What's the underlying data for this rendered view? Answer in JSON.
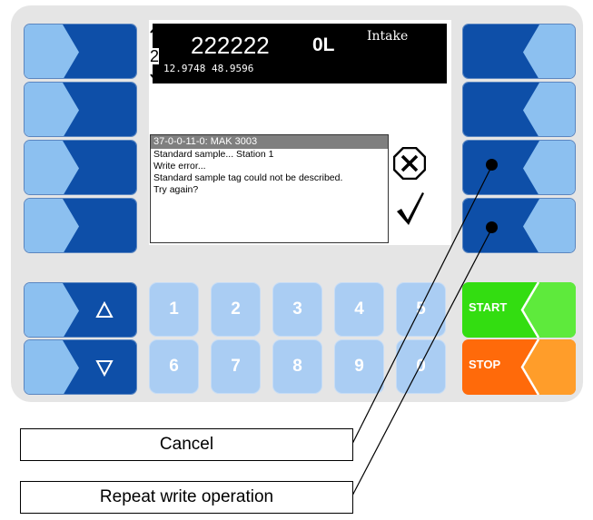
{
  "screen": {
    "page_number": "2",
    "volume_readout": "222222",
    "quantity_readout": "0L",
    "mode_label": "Intake",
    "coordinates": "12.9748 48.9596"
  },
  "message": {
    "title": "37-0-0-11-0: MAK 3003",
    "lines": [
      "Standard sample... Station 1",
      "Write error...",
      "Standard sample tag could not be described.",
      "Try again?"
    ]
  },
  "numpad": {
    "keys": [
      "1",
      "2",
      "3",
      "4",
      "5",
      "6",
      "7",
      "8",
      "9",
      "0"
    ]
  },
  "function_keys": {
    "start_label": "START",
    "stop_label": "STOP"
  },
  "callouts": {
    "cancel_label": "Cancel",
    "repeat_label": "Repeat write operation"
  },
  "colors": {
    "key_dark_blue": "#0e4fa8",
    "key_light_blue": "#8cc0f0",
    "start_green": "#33dd11",
    "stop_orange": "#ff7a10",
    "numkey_blue": "#aacdf3"
  }
}
